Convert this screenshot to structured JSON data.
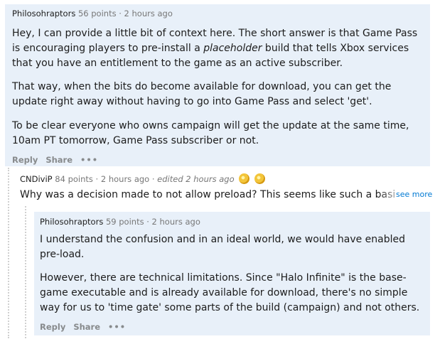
{
  "comment1": {
    "author": "Philosohraptors",
    "points": "56 points",
    "sep": "·",
    "time": "2 hours ago",
    "p1_before": "Hey, I can provide a little bit of context here. The short answer is that Game Pass is encouraging players to pre-install a ",
    "p1_em": "placeholder",
    "p1_after": " build that tells Xbox services that you have an entitlement to the game as an active subscriber.",
    "p2": "That way, when the bits do become available for download, you can get the update right away without having to go into Game Pass and select 'get'.",
    "p3": "To be clear everyone who owns campaign will get the update at the same time, 10am PT tomorrow, Game Pass subscriber or not.",
    "reply": "Reply",
    "share": "Share",
    "more": "•••"
  },
  "comment2": {
    "author": "CNDiviP",
    "points": "84 points",
    "sep": "·",
    "time": "2 hours ago",
    "edited": "edited 2 hours ago",
    "award_icons": [
      "gold-award-icon",
      "silver-award-icon"
    ],
    "text": "Why was a decision made to not allow preload? This seems like such a basic thing to do",
    "see_more": "see more"
  },
  "comment3": {
    "author": "Philosohraptors",
    "points": "59 points",
    "sep": "·",
    "time": "2 hours ago",
    "p1": "I understand the confusion and in an ideal world, we would have enabled pre-load.",
    "p2": "However, there are technical limitations. Since \"Halo Infinite\" is the base-game executable and is already available for download, there's no simple way for us to 'time gate' some parts of the build (campaign) and not others.",
    "reply": "Reply",
    "share": "Share",
    "more": "•••"
  },
  "colors": {
    "highlight_bg": "#e8f0f9",
    "link": "#0079d3",
    "meta": "#777777",
    "actions": "#878a8c"
  }
}
